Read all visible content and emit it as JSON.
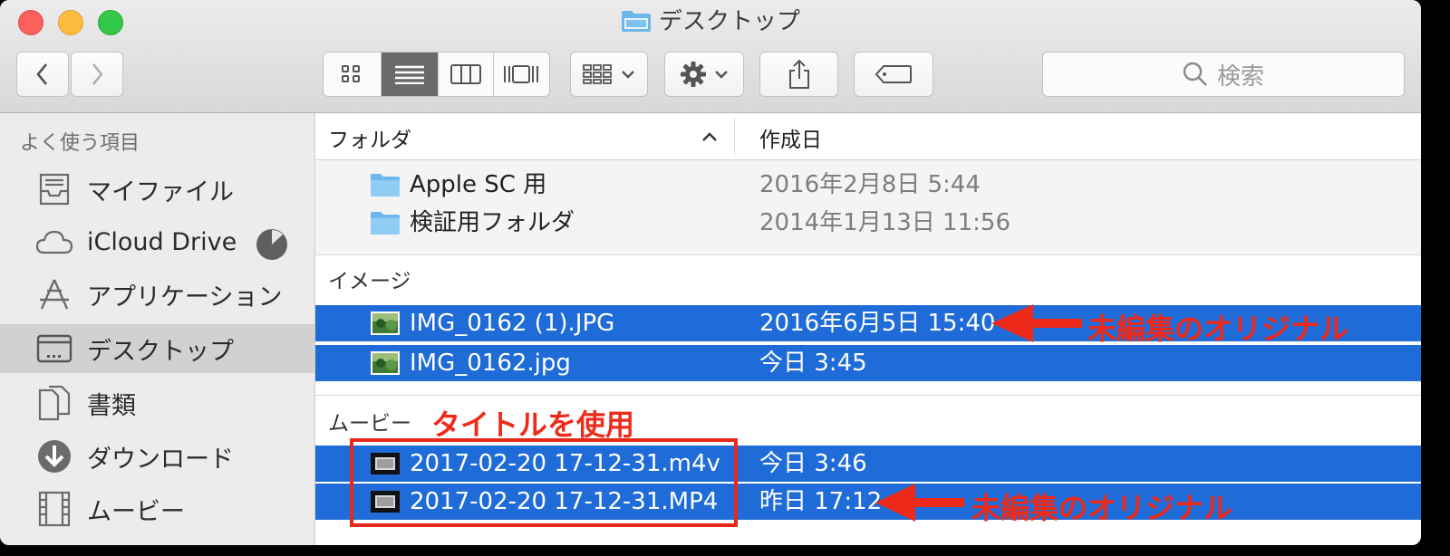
{
  "window": {
    "title": "デスクトップ"
  },
  "toolbar": {
    "back_label": "back",
    "forward_label": "forward",
    "search_placeholder": "検索"
  },
  "sidebar": {
    "section_title": "よく使う項目",
    "items": [
      {
        "label": "マイファイル",
        "icon": "all-my-files-icon"
      },
      {
        "label": "iCloud Drive",
        "icon": "cloud-icon"
      },
      {
        "label": "アプリケーション",
        "icon": "applications-icon"
      },
      {
        "label": "デスクトップ",
        "icon": "desktop-icon",
        "selected": true
      },
      {
        "label": "書類",
        "icon": "documents-icon"
      },
      {
        "label": "ダウンロード",
        "icon": "download-icon"
      },
      {
        "label": "ムービー",
        "icon": "movies-icon"
      }
    ]
  },
  "list": {
    "columns": {
      "name": "フォルダ",
      "sort_indicator": "^",
      "date": "作成日"
    },
    "groups": [
      {
        "title": "",
        "rows": [
          {
            "name": "Apple SC 用",
            "date": "2016年2月8日 5:44",
            "icon": "folder-icon",
            "selected": false
          },
          {
            "name": "検証用フォルダ",
            "date": "2014年1月13日 11:56",
            "icon": "folder-icon",
            "selected": false
          }
        ]
      },
      {
        "title": "イメージ",
        "rows": [
          {
            "name": "IMG_0162 (1).JPG",
            "date": "2016年6月5日 15:40",
            "icon": "image-thumbnail-icon",
            "selected": true
          },
          {
            "name": "IMG_0162.jpg",
            "date": "今日 3:45",
            "icon": "image-thumbnail-icon",
            "selected": true
          }
        ]
      },
      {
        "title": "ムービー",
        "rows": [
          {
            "name": "2017-02-20 17-12-31.m4v",
            "date": "今日 3:46",
            "icon": "movie-thumbnail-icon",
            "selected": true
          },
          {
            "name": "2017-02-20 17-12-31.MP4",
            "date": "昨日 17:12",
            "icon": "movie-thumbnail-icon",
            "selected": true
          }
        ]
      }
    ]
  },
  "annotations": {
    "image_original": "未編集のオリジナル",
    "movie_title": "タイトルを使用",
    "movie_original": "未編集のオリジナル",
    "color": "#ee2a1a"
  }
}
